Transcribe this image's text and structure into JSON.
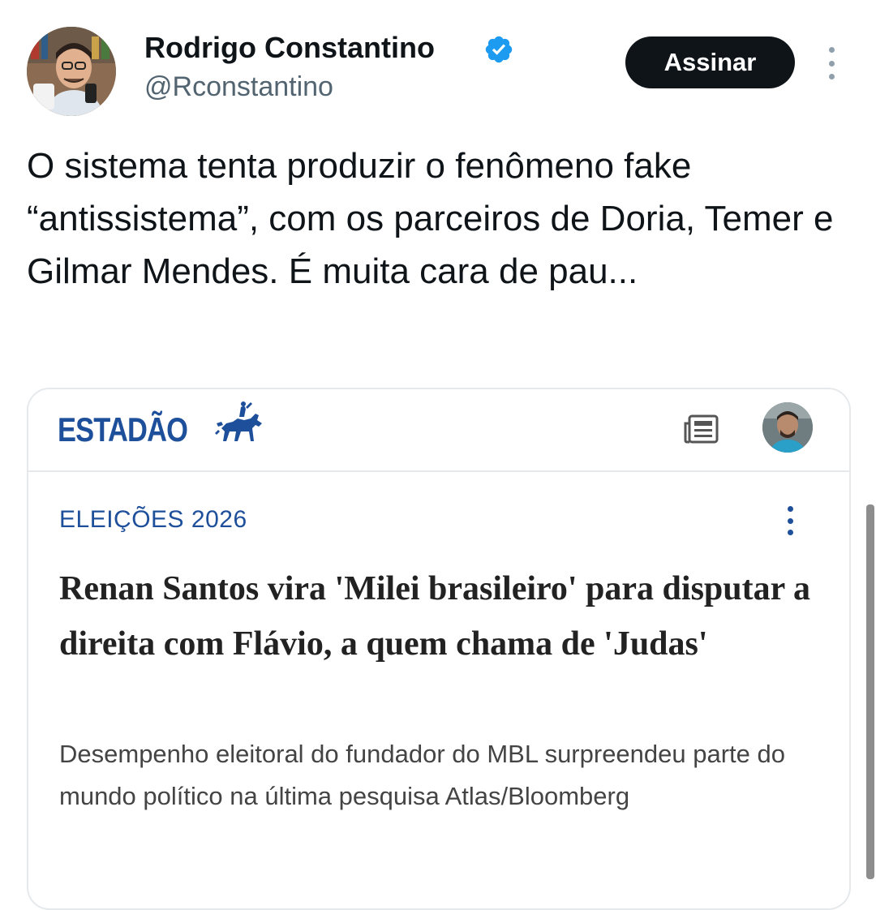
{
  "author": {
    "display_name": "Rodrigo Constantino",
    "handle": "@Rconstantino",
    "verified": true,
    "avatar": "profile-photo"
  },
  "actions": {
    "subscribe_label": "Assinar",
    "more_icon": "more-vertical-icon"
  },
  "tweet": {
    "text": "O sistema tenta produzir o fenômeno fake “antissistema”, com os parceiros de Doria, Temer e Gilmar Mendes. É muita cara de pau..."
  },
  "card": {
    "publisher": "ESTADÃO",
    "section": "ELEIÇÕES 2026",
    "headline": "Renan Santos vira 'Milei brasileiro' para disputar a direita com Flávio, a quem chama de 'Judas'",
    "summary": "Desempenho eleitoral do fundador do MBL surpreendeu parte do mundo político na última pesquisa Atlas/Bloomberg"
  },
  "colors": {
    "text": "#0f1419",
    "muted": "#536471",
    "verified_badge": "#1d9bf0",
    "button_bg": "#0f1419",
    "publisher_blue": "#1d4f9a",
    "border": "#e6e9eb"
  }
}
